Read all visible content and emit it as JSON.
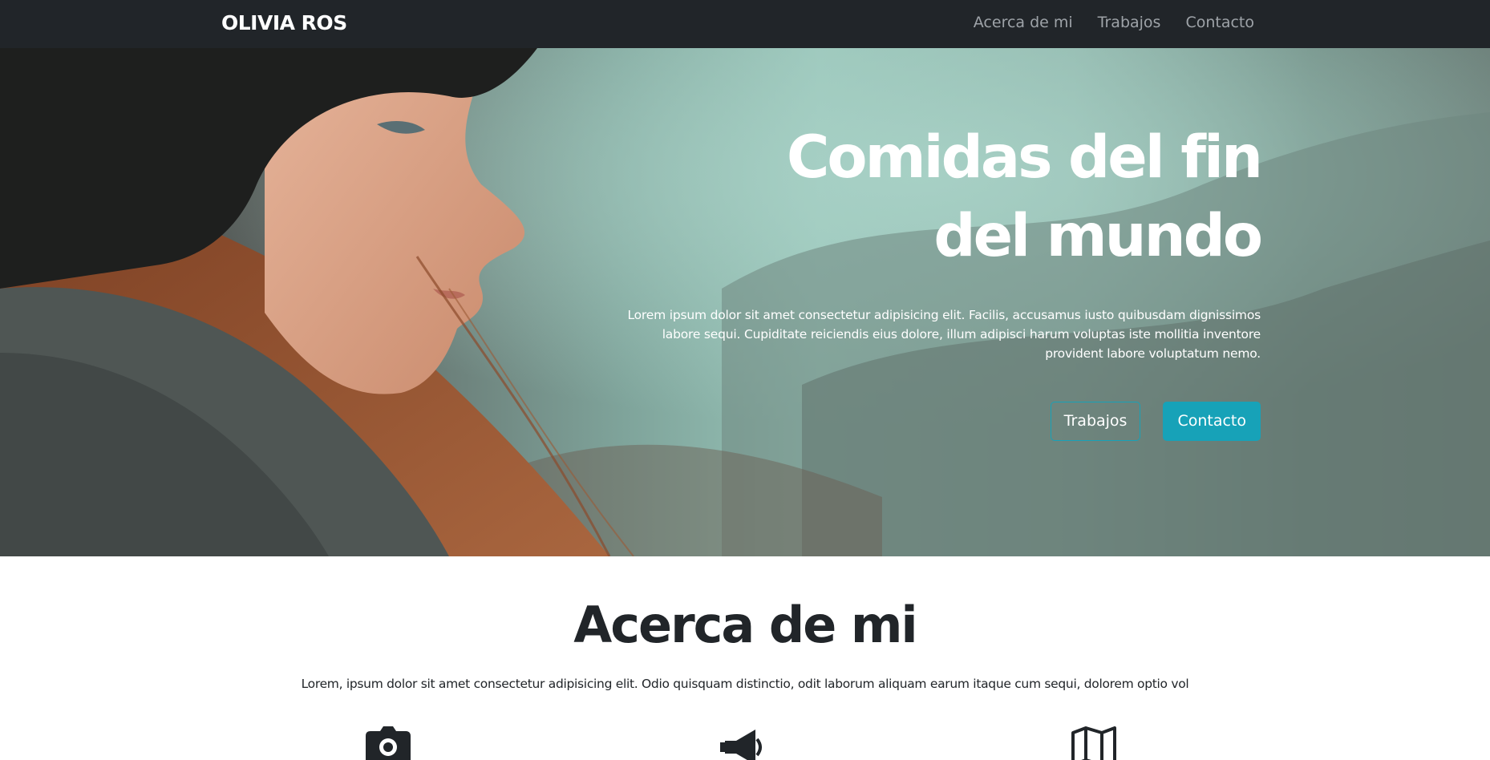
{
  "navbar": {
    "brand": "OLIVIA ROS",
    "links": [
      "Acerca de mi",
      "Trabajos",
      "Contacto"
    ]
  },
  "hero": {
    "title": "Comidas del fin del mundo",
    "text": "Lorem ipsum dolor sit amet consectetur adipisicing elit. Facilis, accusamus iusto quibusdam dignissimos labore sequi. Cupiditate reiciendis eius dolore, illum adipisci harum voluptas iste mollitia inventore provident labore voluptatum nemo.",
    "buttons": {
      "secondary": "Trabajos",
      "primary": "Contacto"
    }
  },
  "about": {
    "title": "Acerca de mi",
    "text": "Lorem, ipsum dolor sit amet consectetur adipisicing elit. Odio quisquam distinctio, odit laborum aliquam earum itaque cum sequi, dolorem optio vol",
    "icons": [
      "camera-icon",
      "bullhorn-icon",
      "map-icon"
    ]
  },
  "colors": {
    "navbar_bg": "#212529",
    "accent": "#17a2b8",
    "text_dark": "#212529",
    "nav_link": "#9ea3a8"
  }
}
